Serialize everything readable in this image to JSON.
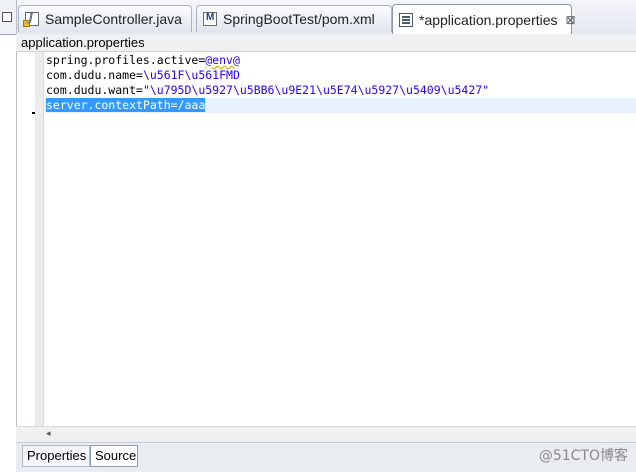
{
  "tabs": [
    {
      "label": "SampleController.java",
      "icon": "java-file-icon"
    },
    {
      "label": "SpringBootTest/pom.xml",
      "icon": "maven-pom-icon"
    },
    {
      "label": "*application.properties",
      "icon": "properties-file-icon",
      "active": true,
      "close": "⊠"
    }
  ],
  "breadcrumb": "application.properties",
  "editor": {
    "lines": [
      {
        "key": "spring.profiles.active=",
        "value": "@env@"
      },
      {
        "key": "com.dudu.name=",
        "value": "\\u561F\\u561FMD"
      },
      {
        "key": "com.dudu.want=",
        "value": "\"\\u795D\\u5927\\u5BB6\\u9E21\\u5E74\\u5927\\u5409\\u5427\""
      },
      {
        "selected": "server.contextPath=/aaa"
      }
    ]
  },
  "scroll_arrow": "◂",
  "bottom_tabs": [
    "Properties",
    "Source"
  ],
  "active_bottom_tab": "Source",
  "watermark": "@51CTO博客",
  "colors": {
    "value_text": "#2a00ff",
    "selection": "#3399ff",
    "current_line": "#e8f2fe"
  }
}
